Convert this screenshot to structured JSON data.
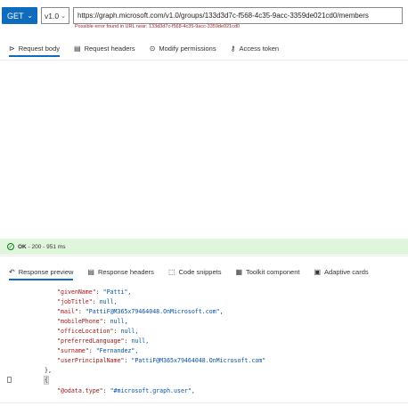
{
  "request": {
    "method": "GET",
    "version": "v1.0",
    "url": "https://graph.microsoft.com/v1.0/groups/133d3d7c-f568-4c35-9acc-3359de021cd0/members",
    "url_error": "Possible error found in URL near: 133d3d7c-f568-4c35-9acc-3359de021cd0"
  },
  "request_tabs": [
    {
      "label": "Request body",
      "icon": "body-icon",
      "active": true
    },
    {
      "label": "Request headers",
      "icon": "headers-icon",
      "active": false
    },
    {
      "label": "Modify permissions",
      "icon": "permissions-icon",
      "active": false
    },
    {
      "label": "Access token",
      "icon": "key-icon",
      "active": false
    }
  ],
  "status": {
    "ok": "OK",
    "detail": " - 200 - 951 ms",
    "color": "#107c10"
  },
  "response_tabs": [
    {
      "label": "Response preview",
      "icon": "reply-icon",
      "active": true
    },
    {
      "label": "Response headers",
      "icon": "headers-icon",
      "active": false
    },
    {
      "label": "Code snippets",
      "icon": "code-icon",
      "active": false
    },
    {
      "label": "Toolkit component",
      "icon": "toolkit-icon",
      "active": false
    },
    {
      "label": "Adaptive cards",
      "icon": "card-icon",
      "active": false
    }
  ],
  "response_lines": [
    {
      "key": "\"givenName\"",
      "value": "\"Patti\","
    },
    {
      "key": "\"jobTitle\"",
      "value": "null,"
    },
    {
      "key": "\"mail\"",
      "value": "\"PattiF@M365x79464048.OnMicrosoft.com\","
    },
    {
      "key": "\"mobilePhone\"",
      "value": "null,"
    },
    {
      "key": "\"officeLocation\"",
      "value": "null,"
    },
    {
      "key": "\"preferredLanguage\"",
      "value": "null,"
    },
    {
      "key": "\"surname\"",
      "value": "\"Fernandez\","
    },
    {
      "key": "\"userPrincipalName\"",
      "value": "\"PattiF@M365x79464048.OnMicrosoft.com\""
    }
  ],
  "response_close": "},",
  "response_open": "{",
  "response_odata": {
    "key": "\"@odata.type\"",
    "value": "\"#microsoft.graph.user\","
  },
  "accent": "#0f6cbd"
}
